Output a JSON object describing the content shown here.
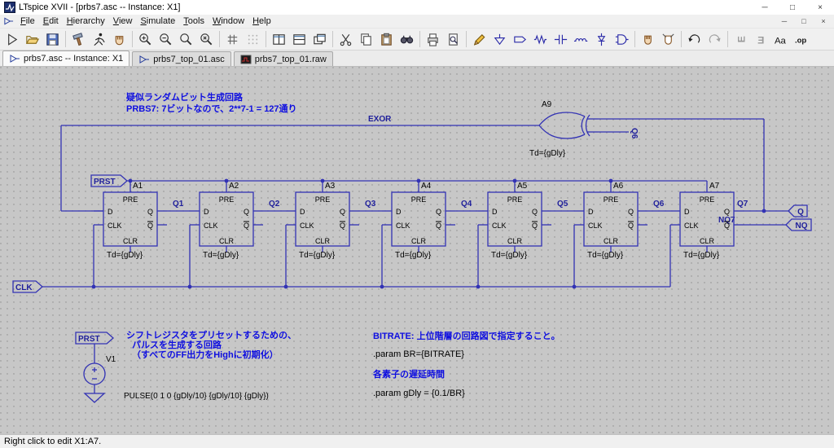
{
  "window": {
    "title": "LTspice XVII - [prbs7.asc -- Instance: X1]",
    "controls": {
      "minimize": "─",
      "maximize": "□",
      "close": "×"
    }
  },
  "menubar": {
    "items": [
      "File",
      "Edit",
      "Hierarchy",
      "View",
      "Simulate",
      "Tools",
      "Window",
      "Help"
    ],
    "mdi_controls": {
      "minimize": "─",
      "restore": "□",
      "close": "×"
    }
  },
  "toolbar": {
    "text_icon": "Aa",
    "op_icon": ".op",
    "rotate_glyph": "E",
    "mirror_glyph": "E"
  },
  "tabs": [
    {
      "label": "prbs7.asc -- Instance: X1"
    },
    {
      "label": "prbs7_top_01.asc"
    },
    {
      "label": "prbs7_top_01.raw"
    }
  ],
  "statusbar": {
    "text": "Right click to edit X1:A7."
  },
  "schematic": {
    "comments": {
      "title1": "疑似ランダムビット生成回路",
      "title2": "PRBS7:  7ビットなので、2**7-1 = 127通り",
      "preset1": "シフトレジスタをプリセットするための、",
      "preset2": "パルスを生成する回路",
      "preset3": "（すべてのFF出力をHighに初期化）",
      "bitrate_note": "BITRATE: 上位階層の回路図で指定すること。",
      "delay_note": "各素子の遅延時間"
    },
    "directives": {
      "param_br": ".param BR={BITRATE}",
      "param_gdly": ".param gDly = {0.1/BR}",
      "pulse": "PULSE(0 1 0 {gDly/10} {gDly/10} {gDly})"
    },
    "labels": {
      "exor": "EXOR",
      "prst": "PRST",
      "prst2": "PRST",
      "clk": "CLK",
      "q": "Q",
      "nq": "NQ",
      "q6_vert": "Q6",
      "q7": "Q7",
      "nq7": "NQ7"
    },
    "net_labels": [
      "Q1",
      "Q2",
      "Q3",
      "Q4",
      "Q5",
      "Q6"
    ],
    "ff_pins": {
      "pre": "PRE",
      "d": "D",
      "q": "Q",
      "clk": "CLK",
      "qbar": "Q",
      "clr": "CLR"
    },
    "ff_td": "Td={gDly}",
    "flipflops": [
      {
        "name": "A1"
      },
      {
        "name": "A2"
      },
      {
        "name": "A3"
      },
      {
        "name": "A4"
      },
      {
        "name": "A5"
      },
      {
        "name": "A6"
      },
      {
        "name": "A7"
      }
    ],
    "xor": {
      "name": "A9",
      "td": "Td={gDly}"
    },
    "vsource": {
      "name": "V1"
    }
  }
}
